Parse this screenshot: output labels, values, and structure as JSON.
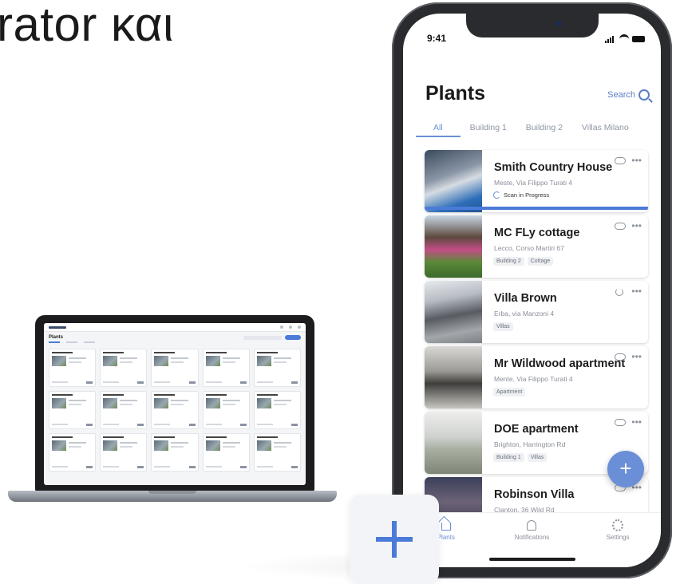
{
  "headline": "rator και",
  "laptop": {
    "page_title": "Plants"
  },
  "phone": {
    "status_time": "9:41",
    "title": "Plants",
    "search_label": "Search",
    "tabs": [
      {
        "label": "All",
        "active": true
      },
      {
        "label": "Building 1",
        "active": false
      },
      {
        "label": "Building 2",
        "active": false
      },
      {
        "label": "Villas Milano",
        "active": false
      }
    ],
    "plants": [
      {
        "name": "Smith Country House",
        "address": "Meste, Via Filippo Turati 4",
        "status": "Scan in Progress",
        "progress": 1.0,
        "tags": [],
        "icon": "cloud-icon",
        "image": "pool-villa"
      },
      {
        "name": "MC FLy cottage",
        "address": "Lecco, Corso Martiri 67",
        "tags": [
          "Building 2",
          "Cottage"
        ],
        "icon": "cloud-icon",
        "image": "garden-cottage"
      },
      {
        "name": "Villa Brown",
        "address": "Erba, via Manzoni 4",
        "tags": [
          "Villas"
        ],
        "icon": "refresh-icon",
        "image": "modern-villa"
      },
      {
        "name": "Mr Wildwood apartment",
        "address": "Mente, Via Filippo Turati 4",
        "tags": [
          "Apartment"
        ],
        "icon": "cloud-icon",
        "image": "interior"
      },
      {
        "name": "DOE apartment",
        "address": "Brighton, Harrington Rd",
        "tags": [
          "Building 1",
          "Villas"
        ],
        "icon": "cloud-icon",
        "image": "living-room"
      },
      {
        "name": "Robinson Villa",
        "address": "Clanton, 36 Wild Rd",
        "tags": [],
        "icon": "cloud-icon",
        "image": "villa-night"
      }
    ],
    "fab_label": "+",
    "nav": [
      {
        "label": "Plants",
        "icon": "home-icon",
        "active": true
      },
      {
        "label": "Notifications",
        "icon": "bell-icon",
        "active": false
      },
      {
        "label": "Settings",
        "icon": "gear-icon",
        "active": false
      }
    ]
  },
  "add_tile": {
    "icon": "plus-icon"
  },
  "colors": {
    "accent": "#6b8fd6",
    "accent_dark": "#4a7bd8",
    "device": "#2a2b2e"
  }
}
